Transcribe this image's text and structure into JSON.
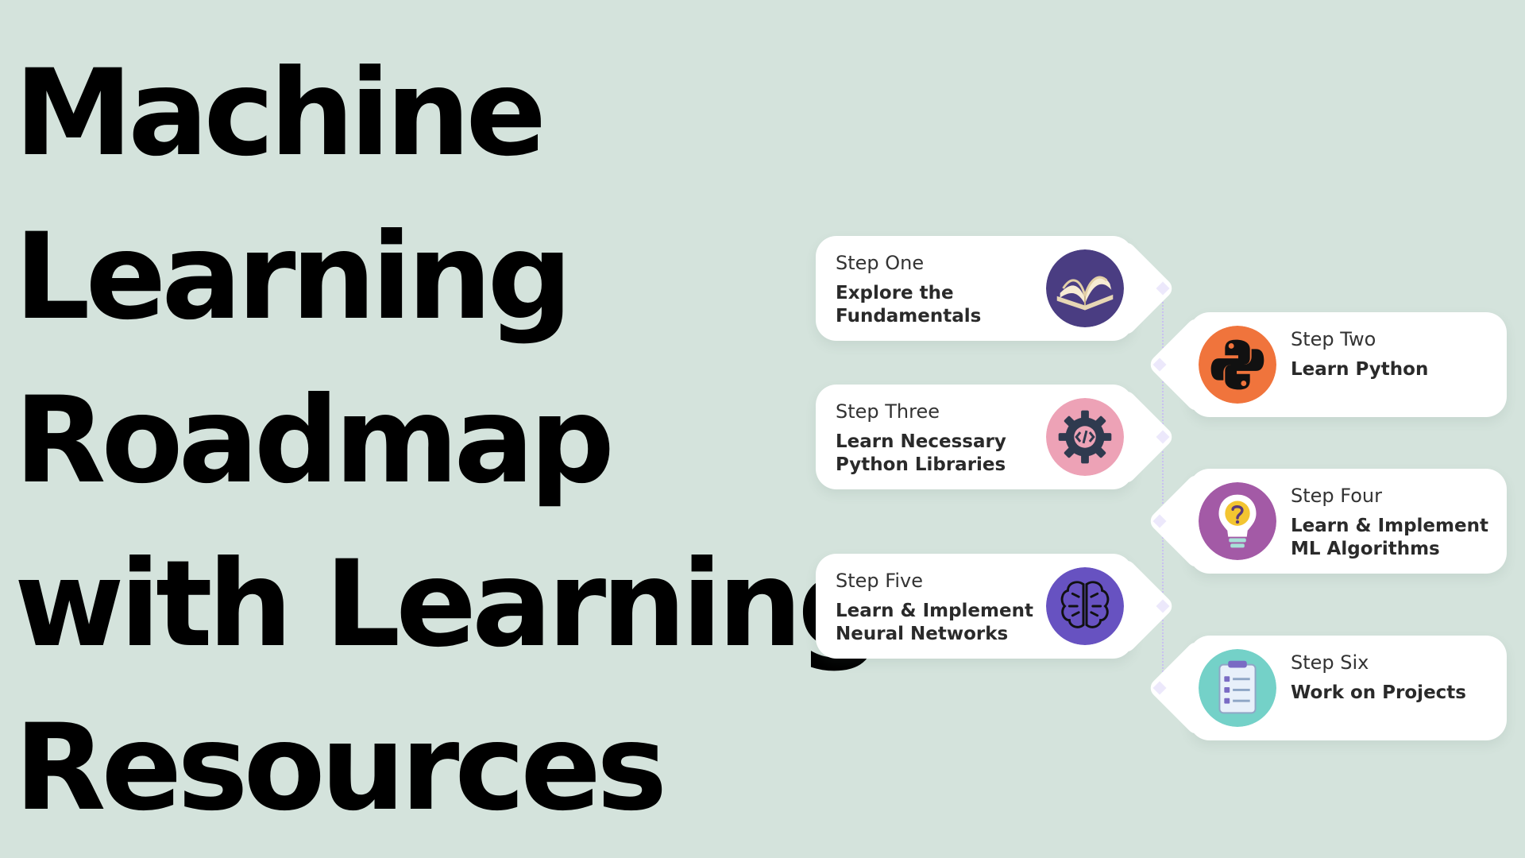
{
  "title": {
    "lines": [
      "Machine",
      "Learning",
      "Roadmap",
      "with Learning",
      "Resources"
    ]
  },
  "steps": [
    {
      "label": "Step One",
      "text": "Explore the\nFundamentals",
      "icon": "open-book-icon",
      "icon_bg": "#4a3d82"
    },
    {
      "label": "Step Two",
      "text": "Learn Python",
      "icon": "python-logo-icon",
      "icon_bg": "#f0743c"
    },
    {
      "label": "Step Three",
      "text": "Learn Necessary\nPython Libraries",
      "icon": "code-gear-icon",
      "icon_bg": "#eda2b6"
    },
    {
      "label": "Step Four",
      "text": "Learn & Implement\nML Algorithms",
      "icon": "lightbulb-question-icon",
      "icon_bg": "#a35aa6"
    },
    {
      "label": "Step Five",
      "text": "Learn & Implement\nNeural Networks",
      "icon": "brain-icon",
      "icon_bg": "#6752c1"
    },
    {
      "label": "Step Six",
      "text": "Work on Projects",
      "icon": "clipboard-checklist-icon",
      "icon_bg": "#74d1c8"
    }
  ],
  "colors": {
    "background": "#d4e3dc",
    "card": "#ffffff",
    "title_text": "#000000",
    "connector": "#c9c0f0"
  }
}
